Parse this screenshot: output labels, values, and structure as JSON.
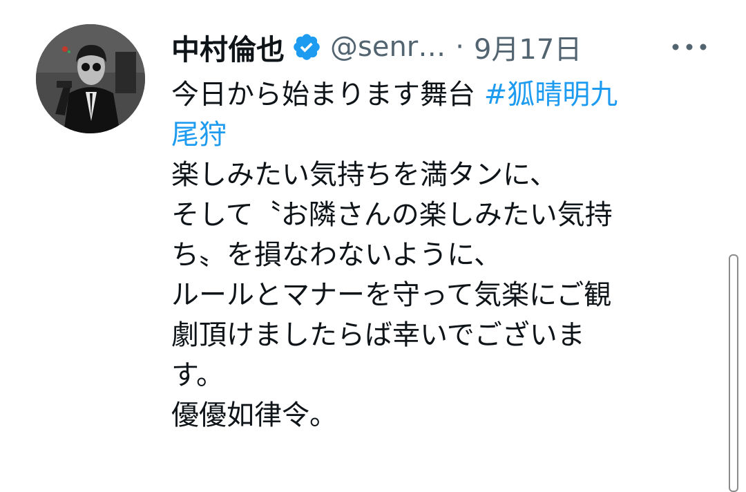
{
  "tweet": {
    "author": {
      "display_name": "中村倫也",
      "handle": "@senr…",
      "verified": true
    },
    "separator": "·",
    "date": "9月17日",
    "more_icon": "more-horizontal-icon",
    "text": {
      "line1_plain": "今日から始まります舞台 ",
      "line1_hashtag": "#狐晴明九",
      "line2_hashtag": "尾狩",
      "line3": "楽しみたい気持ちを満タンに、",
      "line4": "そして〝お隣さんの楽しみたい気持",
      "line5": "ち〟を損なわないように、",
      "line6": "ルールとマナーを守って気楽にご観",
      "line7": "劇頂けましたらば幸いでございま",
      "line8": "す。",
      "line9": "優優如律令。"
    }
  },
  "colors": {
    "text": "#0f1419",
    "secondary": "#536471",
    "link": "#1d9bf0",
    "verified_badge": "#1d9bf0"
  }
}
